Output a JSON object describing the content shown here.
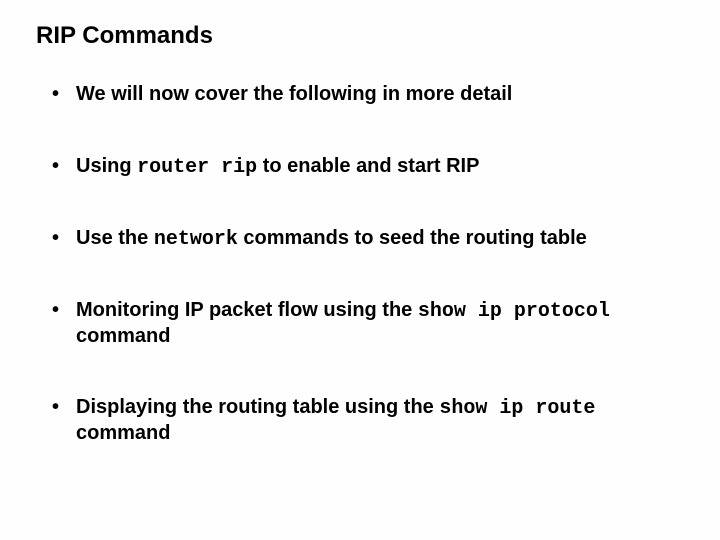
{
  "title": "RIP Commands",
  "bullets": [
    {
      "pre": "We will now cover the following in more detail",
      "code": "",
      "post": ""
    },
    {
      "pre": "Using ",
      "code": "router rip",
      "post": " to enable  and start RIP"
    },
    {
      "pre": "Use the ",
      "code": "network",
      "post": " commands to seed the routing table"
    },
    {
      "pre": "Monitoring IP packet flow using the ",
      "code": "show ip protocol",
      "post": " command"
    },
    {
      "pre": "Displaying the routing table using the ",
      "code": "show ip route",
      "post": " command"
    }
  ]
}
